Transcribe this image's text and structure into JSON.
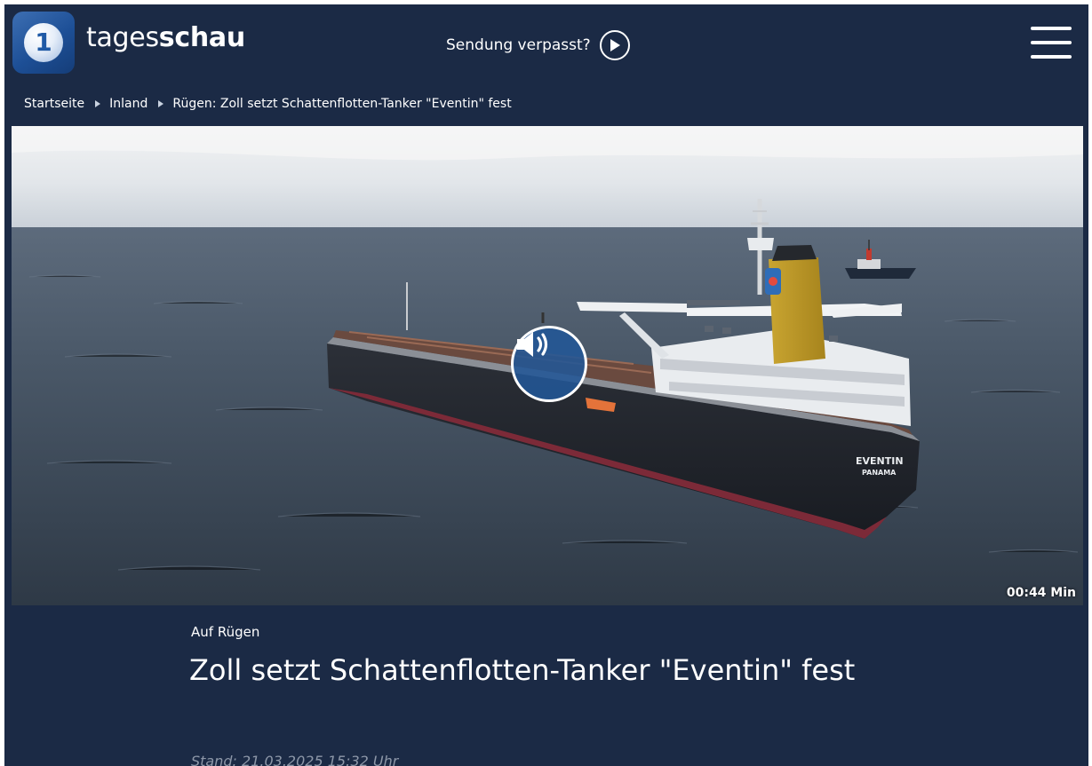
{
  "header": {
    "brand_light": "tages",
    "brand_bold": "schau",
    "missed_label": "Sendung verpasst?"
  },
  "breadcrumb": [
    {
      "label": "Startseite"
    },
    {
      "label": "Inland"
    },
    {
      "label": "Rügen: Zoll setzt Schattenflotten-Tanker \"Eventin\" fest"
    }
  ],
  "media": {
    "duration": "00:44 Min",
    "ship_name": "EVENTIN",
    "ship_port": "PANAMA"
  },
  "article": {
    "topline": "Auf Rügen",
    "headline": "Zoll setzt Schattenflotten-Tanker \"Eventin\" fest",
    "timestamp": "Stand: 21.03.2025 15:32 Uhr"
  },
  "colors": {
    "background": "#1b2a45",
    "brand_blue": "#1f5aa6",
    "timestamp_gray": "#8d97a8"
  },
  "icons": [
    "tagesschau-logo-icon",
    "play-icon",
    "menu-icon",
    "breadcrumb-arrow-icon",
    "speaker-icon"
  ]
}
